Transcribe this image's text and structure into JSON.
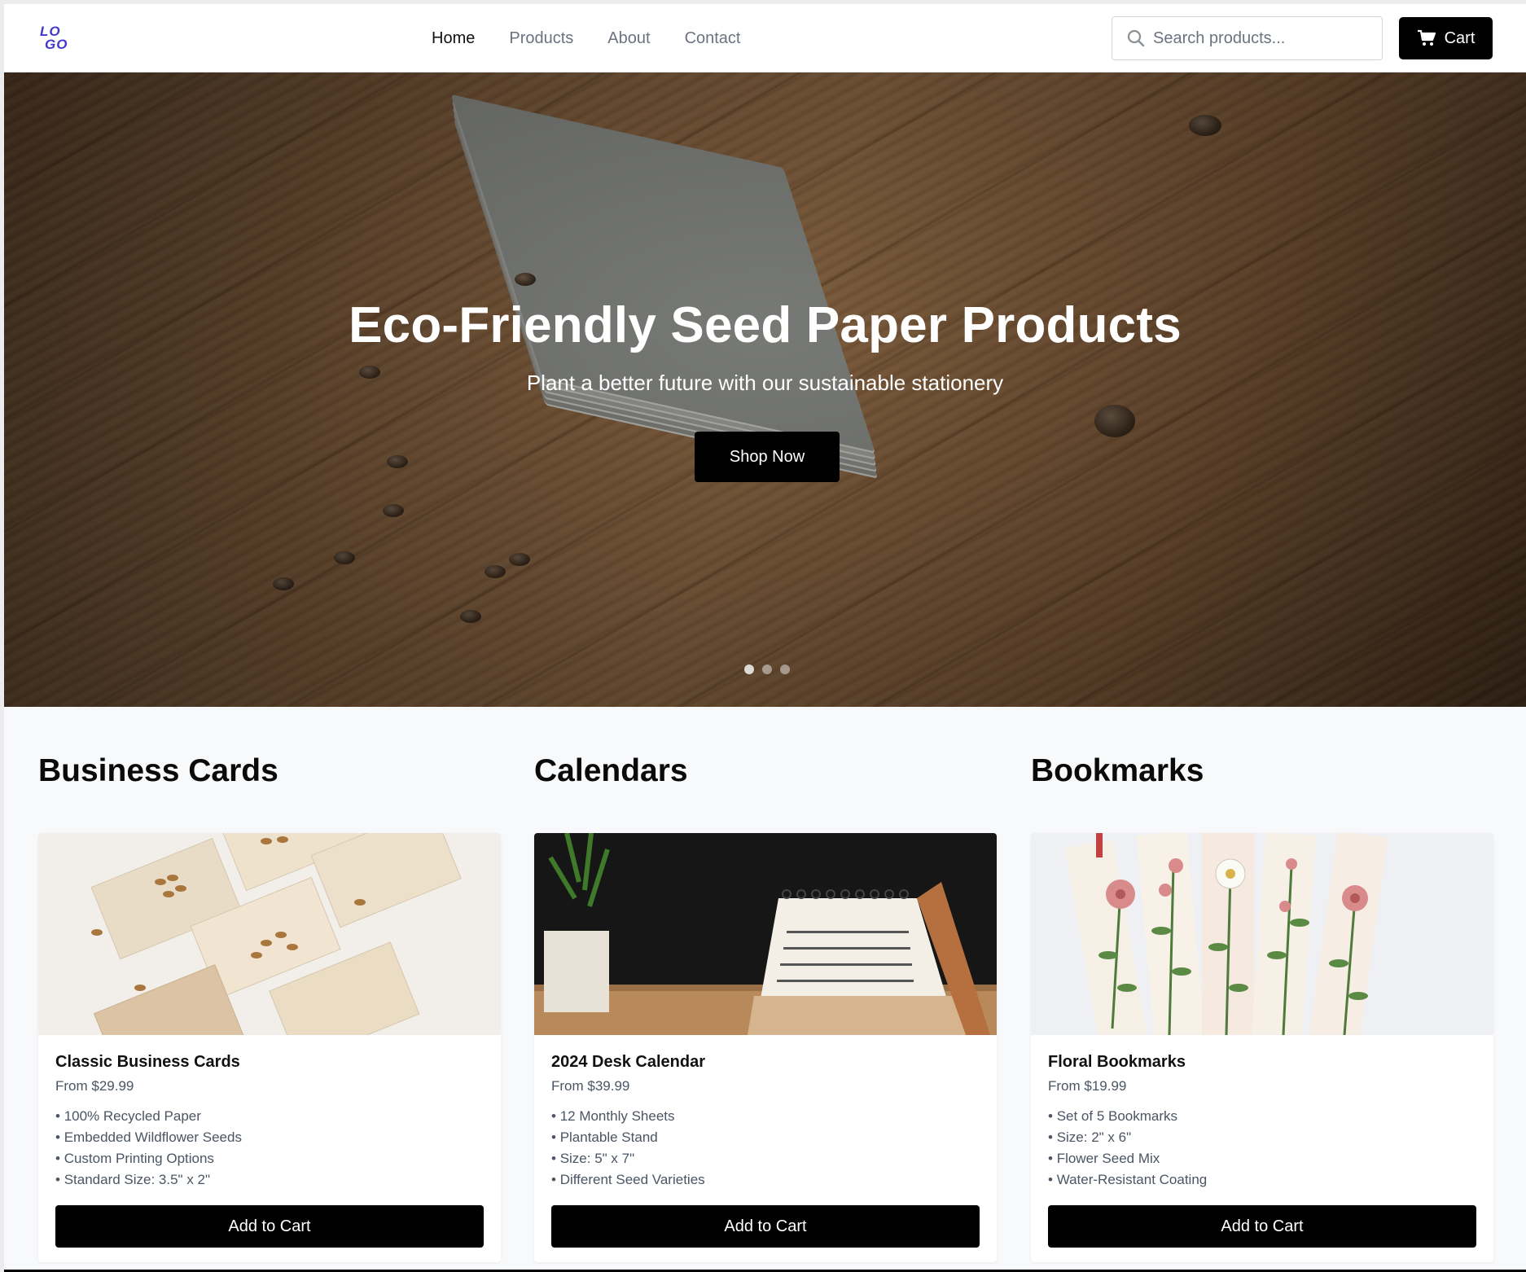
{
  "header": {
    "logo_line1": "LO",
    "logo_line2": "GO",
    "nav": [
      {
        "label": "Home",
        "active": true
      },
      {
        "label": "Products",
        "active": false
      },
      {
        "label": "About",
        "active": false
      },
      {
        "label": "Contact",
        "active": false
      }
    ],
    "search_placeholder": "Search products...",
    "cart_label": "Cart"
  },
  "hero": {
    "title": "Eco-Friendly Seed Paper Products",
    "subtitle": "Plant a better future with our sustainable stationery",
    "cta_label": "Shop Now",
    "slides": 3,
    "active_slide": 1
  },
  "categories": [
    {
      "heading": "Business Cards",
      "product": {
        "name": "Classic Business Cards",
        "price": "From $29.99",
        "features": [
          "100% Recycled Paper",
          "Embedded Wildflower Seeds",
          "Custom Printing Options",
          "Standard Size: 3.5\" x 2\""
        ],
        "button": "Add to Cart"
      }
    },
    {
      "heading": "Calendars",
      "product": {
        "name": "2024 Desk Calendar",
        "price": "From $39.99",
        "features": [
          "12 Monthly Sheets",
          "Plantable Stand",
          "Size: 5\" x 7\"",
          "Different Seed Varieties"
        ],
        "button": "Add to Cart"
      }
    },
    {
      "heading": "Bookmarks",
      "product": {
        "name": "Floral Bookmarks",
        "price": "From $19.99",
        "features": [
          "Set of 5 Bookmarks",
          "Size: 2\" x 6\"",
          "Flower Seed Mix",
          "Water-Resistant Coating"
        ],
        "button": "Add to Cart"
      }
    }
  ],
  "colors": {
    "accent": "#000000",
    "logo": "#4338ca",
    "muted_text": "#6b7280"
  },
  "icons": [
    "search-icon",
    "cart-icon"
  ]
}
